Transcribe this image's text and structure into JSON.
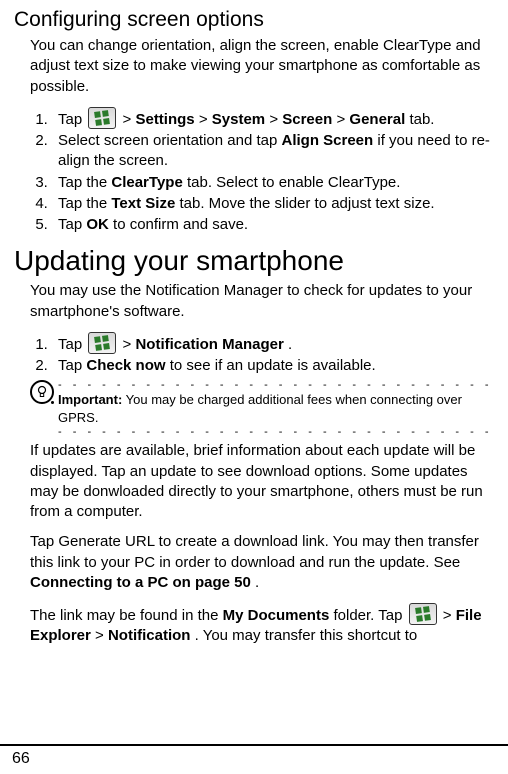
{
  "section1": {
    "heading": "Configuring screen options",
    "intro": "You can change orientation, align the screen, enable ClearType and adjust text size to make viewing your smartphone as comfortable as possible.",
    "steps": {
      "s1_pre": "Tap ",
      "s1_gt1": " > ",
      "s1_b1": "Settings",
      "s1_gt2": " > ",
      "s1_b2": "System",
      "s1_gt3": " > ",
      "s1_b3": "Screen",
      "s1_gt4": " > ",
      "s1_b4": "General",
      "s1_post": " tab.",
      "s2_pre": "Select screen orientation and tap ",
      "s2_b1": "Align Screen",
      "s2_post": " if you need to re-align the screen.",
      "s3_pre": "Tap the ",
      "s3_b1": "ClearType",
      "s3_post": " tab. Select to enable ClearType.",
      "s4_pre": "Tap the ",
      "s4_b1": "Text Size",
      "s4_post": " tab. Move the slider to adjust text size.",
      "s5_pre": "Tap ",
      "s5_b1": "OK",
      "s5_post": " to confirm and save."
    }
  },
  "section2": {
    "heading": "Updating your smartphone",
    "intro": "You may use the Notification Manager to check for updates to your smartphone's software.",
    "steps": {
      "s1_pre": "Tap ",
      "s1_gt1": " > ",
      "s1_b1": "Notification Manager",
      "s1_post": ".",
      "s2_pre": "Tap ",
      "s2_b1": "Check now",
      "s2_post": " to see if an update is available."
    },
    "note": {
      "label": "Important:",
      "text": " You may be charged additional fees when connecting over GPRS."
    },
    "para2": "If updates are available, brief information about each update will be displayed. Tap an update to see download options. Some updates may be donwloaded directly to your smartphone, others must be run from a computer.",
    "para3_pre": "Tap Generate URL to create a download link. You may then transfer this link to your PC in order to download and run the update. See ",
    "para3_b1": "Connecting to a PC on page 50",
    "para3_post": ".",
    "para4_pre": "The link may be found in the ",
    "para4_b1": "My Documents",
    "para4_mid": " folder. Tap ",
    "para4_gt1": " > ",
    "para4_b2": "File Explorer",
    "para4_gt2": " > ",
    "para4_b3": "Notification",
    "para4_post": ". You may transfer this shortcut to"
  },
  "footer": {
    "page_number": "66"
  },
  "icons": {
    "start": "windows-start-icon",
    "note": "light-bulb-icon"
  }
}
